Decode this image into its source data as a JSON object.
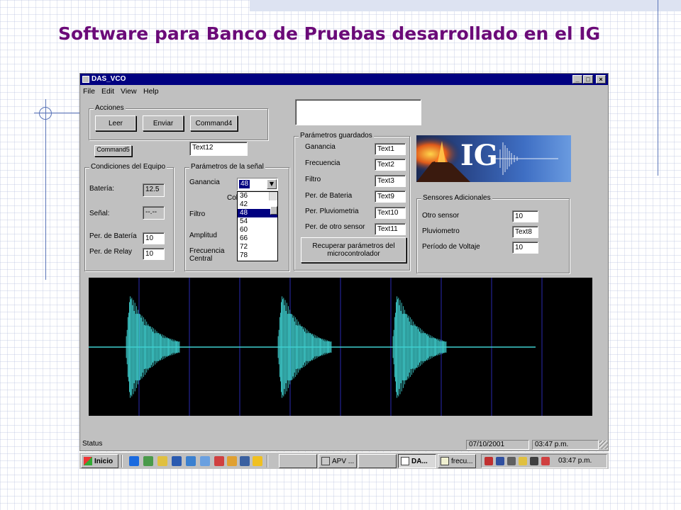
{
  "slide": {
    "title": "Software para Banco de Pruebas desarrollado en el IG"
  },
  "window": {
    "title": "DAS_VCO",
    "controls": {
      "minimize": "_",
      "maximize": "□",
      "close": "×"
    },
    "menu": [
      "File",
      "Edit",
      "View",
      "Help"
    ]
  },
  "acciones": {
    "label": "Acciones",
    "buttons": [
      "Leer",
      "Enviar",
      "Command4"
    ]
  },
  "command5": "Command5",
  "text12": "Text12",
  "condiciones": {
    "label": "Condiciones del Equipo",
    "bateria_label": "Batería:",
    "bateria_value": "12.5",
    "senal_label": "Señal:",
    "senal_value": "--.--",
    "per_bateria_label": "Per. de Batería",
    "per_bateria_value": "10",
    "per_relay_label": "Per. de Relay",
    "per_relay_value": "10"
  },
  "parametros_senal": {
    "label": "Parámetros de la señal",
    "ganancia_label": "Ganancia",
    "ganancia_value": "48",
    "col_label": "Col",
    "filtro_label": "Filtro",
    "amplitud_label": "Amplitud",
    "frecuencia_label": "Frecuencia Central",
    "dropdown_options": [
      "36",
      "42",
      "48",
      "54",
      "60",
      "66",
      "72",
      "78"
    ],
    "dropdown_selected": "48"
  },
  "parametros_guardados": {
    "label": "Parámetros guardados",
    "rows": [
      {
        "label": "Ganancia",
        "value": "Text1"
      },
      {
        "label": "Frecuencia",
        "value": "Text2"
      },
      {
        "label": "Filtro",
        "value": "Text3"
      },
      {
        "label": "Per. de Bateria",
        "value": "Text9"
      },
      {
        "label": "Per. Pluviometria",
        "value": "Text10"
      },
      {
        "label": "Per. de otro sensor",
        "value": "Text11"
      }
    ],
    "recover_button": "Recuperar parámetros del microcontrolador"
  },
  "banner": {
    "text": "IG"
  },
  "sensores": {
    "label": "Sensores Adicionales",
    "rows": [
      {
        "label": "Otro sensor",
        "value": "10"
      },
      {
        "label": "Pluviometro",
        "value": "Text8"
      },
      {
        "label": "Período de Voltaje",
        "value": "10"
      }
    ]
  },
  "statusbar": {
    "status": "Status",
    "date": "07/10/2001",
    "time": "03:47 p.m."
  },
  "taskbar": {
    "start": "Inicio",
    "tasks": [
      "",
      "APV ...",
      "",
      "DA...",
      "frecu..."
    ],
    "clock": "03:47 p.m."
  },
  "colors": {
    "title": "#6b0a78",
    "titlebar": "#000080",
    "waveform": "#3fd0d0",
    "gridline": "#2a2ab0"
  }
}
